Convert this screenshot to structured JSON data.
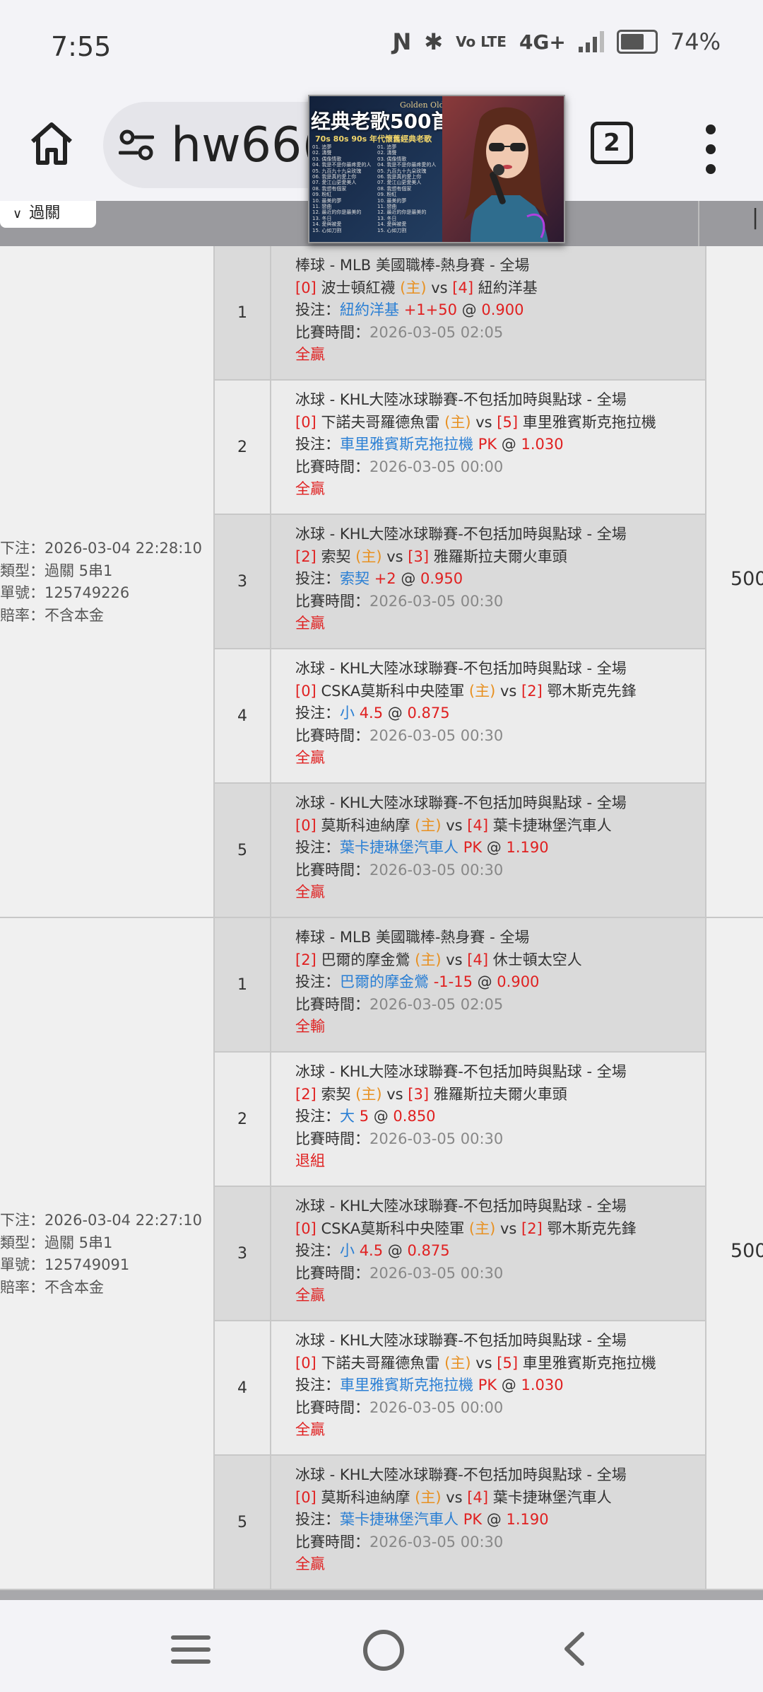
{
  "status": {
    "time": "7:55",
    "network": "4G+",
    "battery": "74%",
    "battery_level": 0.74,
    "lte": "Vo LTE"
  },
  "browser": {
    "url": "hw66(",
    "tabs_count": "2"
  },
  "ad": {
    "small": "Golden Oldies Songs",
    "title": "经典老歌500首",
    "sub": "70s 80s 90s 年代懷舊經典老歌",
    "list1": [
      "01. 追夢",
      "02. 濤聲",
      "03. 偶像情歌",
      "04. 我是不是你最疼愛的人",
      "05. 九百九十九朵玫瑰",
      "06. 我是真的愛上你",
      "07. 愛江山更愛美人",
      "08. 我想有個家",
      "09. 粉紅",
      "10. 最美的夢",
      "11. 戀曲",
      "12. 最近的你是最美的",
      "13. 冬日",
      "14. 愛與被愛",
      "15. 心如刀割"
    ],
    "list2": [
      "01. 追夢",
      "02. 濤聲",
      "03. 偶像情歌",
      "04. 我是不是你最疼愛的人",
      "05. 九百九十九朵玫瑰",
      "06. 我是真的愛上你",
      "07. 愛江山更愛美人",
      "08. 我想有個家",
      "09. 粉紅",
      "10. 最美的夢",
      "11. 戀曲",
      "12. 最近的你是最美的",
      "13. 冬日",
      "14. 愛與被愛",
      "15. 心如刀割"
    ]
  },
  "header": {
    "filter_label": "過關"
  },
  "labels": {
    "bet": "投注：",
    "time": "比賽時間：",
    "home": "(主)",
    "vs": "vs"
  },
  "groups": [
    {
      "info": [
        "下注：2026-03-04 22:28:10",
        "類型：過關 5串1",
        "單號：125749226",
        "賠率：不含本金"
      ],
      "amount": "500",
      "legs": [
        {
          "num": "1",
          "league": "棒球 - MLB 美國職棒-熱身賽 - 全場",
          "home_rank": "[0]",
          "home": "波士頓紅襪",
          "away_rank": "[4]",
          "away": "紐約洋基",
          "pick": "紐約洋基",
          "line": "+1+50",
          "odds": "0.900",
          "time": "2026-03-05 02:05",
          "result": "全贏"
        },
        {
          "num": "2",
          "league": "冰球 - KHL大陸冰球聯賽-不包括加時與點球 - 全場",
          "home_rank": "[0]",
          "home": "下諾夫哥羅德魚雷",
          "away_rank": "[5]",
          "away": "車里雅賓斯克拖拉機",
          "pick": "車里雅賓斯克拖拉機",
          "line": "PK",
          "odds": "1.030",
          "time": "2026-03-05 00:00",
          "result": "全贏"
        },
        {
          "num": "3",
          "league": "冰球 - KHL大陸冰球聯賽-不包括加時與點球 - 全場",
          "home_rank": "[2]",
          "home": "索契",
          "away_rank": "[3]",
          "away": "雅羅斯拉夫爾火車頭",
          "pick": "索契",
          "line": "+2",
          "odds": "0.950",
          "time": "2026-03-05 00:30",
          "result": "全贏"
        },
        {
          "num": "4",
          "league": "冰球 - KHL大陸冰球聯賽-不包括加時與點球 - 全場",
          "home_rank": "[0]",
          "home": "CSKA莫斯科中央陸軍",
          "away_rank": "[2]",
          "away": "鄂木斯克先鋒",
          "pick": "小",
          "line": "4.5",
          "odds": "0.875",
          "time": "2026-03-05 00:30",
          "result": "全贏"
        },
        {
          "num": "5",
          "league": "冰球 - KHL大陸冰球聯賽-不包括加時與點球 - 全場",
          "home_rank": "[0]",
          "home": "莫斯科迪納摩",
          "away_rank": "[4]",
          "away": "葉卡捷琳堡汽車人",
          "pick": "葉卡捷琳堡汽車人",
          "line": "PK",
          "odds": "1.190",
          "time": "2026-03-05 00:30",
          "result": "全贏"
        }
      ]
    },
    {
      "info": [
        "下注：2026-03-04 22:27:10",
        "類型：過關 5串1",
        "單號：125749091",
        "賠率：不含本金"
      ],
      "amount": "500",
      "legs": [
        {
          "num": "1",
          "league": "棒球 - MLB 美國職棒-熱身賽 - 全場",
          "home_rank": "[2]",
          "home": "巴爾的摩金鶯",
          "away_rank": "[4]",
          "away": "休士頓太空人",
          "pick": "巴爾的摩金鶯",
          "line": "-1-15",
          "odds": "0.900",
          "time": "2026-03-05 02:05",
          "result": "全輸"
        },
        {
          "num": "2",
          "league": "冰球 - KHL大陸冰球聯賽-不包括加時與點球 - 全場",
          "home_rank": "[2]",
          "home": "索契",
          "away_rank": "[3]",
          "away": "雅羅斯拉夫爾火車頭",
          "pick": "大",
          "line": "5",
          "odds": "0.850",
          "time": "2026-03-05 00:30",
          "result": "退組"
        },
        {
          "num": "3",
          "league": "冰球 - KHL大陸冰球聯賽-不包括加時與點球 - 全場",
          "home_rank": "[0]",
          "home": "CSKA莫斯科中央陸軍",
          "away_rank": "[2]",
          "away": "鄂木斯克先鋒",
          "pick": "小",
          "line": "4.5",
          "odds": "0.875",
          "time": "2026-03-05 00:30",
          "result": "全贏"
        },
        {
          "num": "4",
          "league": "冰球 - KHL大陸冰球聯賽-不包括加時與點球 - 全場",
          "home_rank": "[0]",
          "home": "下諾夫哥羅德魚雷",
          "away_rank": "[5]",
          "away": "車里雅賓斯克拖拉機",
          "pick": "車里雅賓斯克拖拉機",
          "line": "PK",
          "odds": "1.030",
          "time": "2026-03-05 00:00",
          "result": "全贏"
        },
        {
          "num": "5",
          "league": "冰球 - KHL大陸冰球聯賽-不包括加時與點球 - 全場",
          "home_rank": "[0]",
          "home": "莫斯科迪納摩",
          "away_rank": "[4]",
          "away": "葉卡捷琳堡汽車人",
          "pick": "葉卡捷琳堡汽車人",
          "line": "PK",
          "odds": "1.190",
          "time": "2026-03-05 00:30",
          "result": "全贏"
        }
      ]
    }
  ]
}
